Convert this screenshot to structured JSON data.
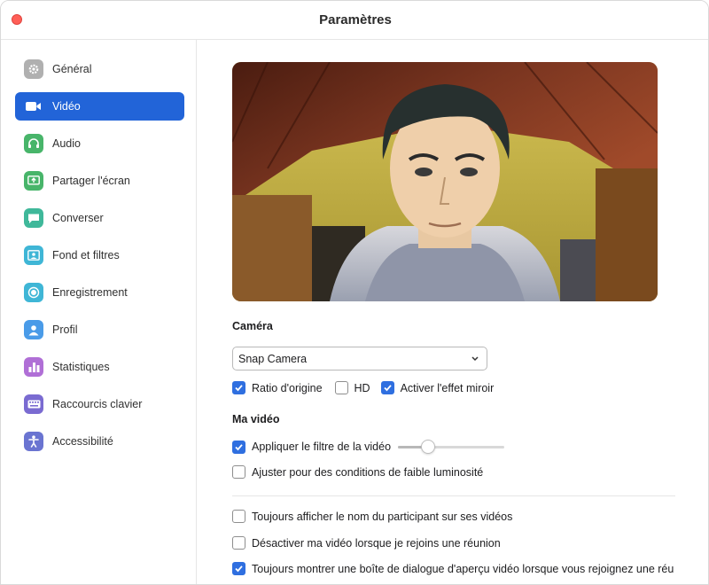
{
  "window": {
    "title": "Paramètres"
  },
  "sidebar": {
    "items": [
      {
        "label": "Général",
        "icon": "gear-icon",
        "color": "#b0b0b0"
      },
      {
        "label": "Vidéo",
        "icon": "video-camera-icon",
        "color": "#2264d8"
      },
      {
        "label": "Audio",
        "icon": "headphones-icon",
        "color": "#48b56a"
      },
      {
        "label": "Partager l'écran",
        "icon": "share-screen-icon",
        "color": "#48b56a"
      },
      {
        "label": "Converser",
        "icon": "chat-bubble-icon",
        "color": "#3fb89a"
      },
      {
        "label": "Fond et filtres",
        "icon": "background-filter-icon",
        "color": "#3fb6d6"
      },
      {
        "label": "Enregistrement",
        "icon": "record-icon",
        "color": "#3fb6d6"
      },
      {
        "label": "Profil",
        "icon": "person-icon",
        "color": "#4a9be8"
      },
      {
        "label": "Statistiques",
        "icon": "bar-chart-icon",
        "color": "#b06fd6"
      },
      {
        "label": "Raccourcis clavier",
        "icon": "keyboard-icon",
        "color": "#7a6bd1"
      },
      {
        "label": "Accessibilité",
        "icon": "accessibility-icon",
        "color": "#6a74d1"
      }
    ],
    "active_index": 1
  },
  "camera": {
    "section_title": "Caméra",
    "selected": "Snap Camera",
    "options": [
      {
        "label": "Ratio d'origine",
        "checked": true
      },
      {
        "label": "HD",
        "checked": false
      },
      {
        "label": "Activer l'effet miroir",
        "checked": true
      }
    ]
  },
  "my_video": {
    "section_title": "Ma vidéo",
    "filter": {
      "label": "Appliquer le filtre de la vidéo",
      "checked": true,
      "slider_value": 0.28
    },
    "low_light": {
      "label": "Ajuster pour des conditions de faible luminosité",
      "checked": false
    }
  },
  "general_options": [
    {
      "label": "Toujours afficher le nom du participant sur ses vidéos",
      "checked": false
    },
    {
      "label": "Désactiver ma vidéo lorsque je rejoins une réunion",
      "checked": false
    },
    {
      "label": "Toujours montrer une boîte de dialogue d'aperçu vidéo lorsque vous rejoignez une réu",
      "checked": true
    }
  ],
  "colors": {
    "accent": "#2264d8",
    "checkbox": "#2f6fe0",
    "close_button": "#ff5f57"
  }
}
